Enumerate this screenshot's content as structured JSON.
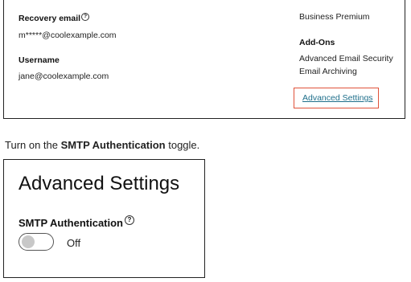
{
  "account": {
    "recovery_email_label": "Recovery email",
    "recovery_email_value": "m*****@coolexample.com",
    "username_label": "Username",
    "username_value": "jane@coolexample.com",
    "plan": "Business Premium",
    "addons_label": "Add-Ons",
    "addons": [
      "Advanced Email Security",
      "Email Archiving"
    ],
    "advanced_settings_link": "Advanced Settings",
    "highlight_color": "#e0523a",
    "link_color": "#1f6f8b"
  },
  "instruction": {
    "prefix": "Turn on the ",
    "emphasis": "SMTP Authentication",
    "suffix": " toggle."
  },
  "advanced": {
    "title": "Advanced Settings",
    "smtp_label": "SMTP Authentication",
    "toggle_state": "Off",
    "toggle_on": false,
    "help_icon": "question-circle-icon"
  }
}
